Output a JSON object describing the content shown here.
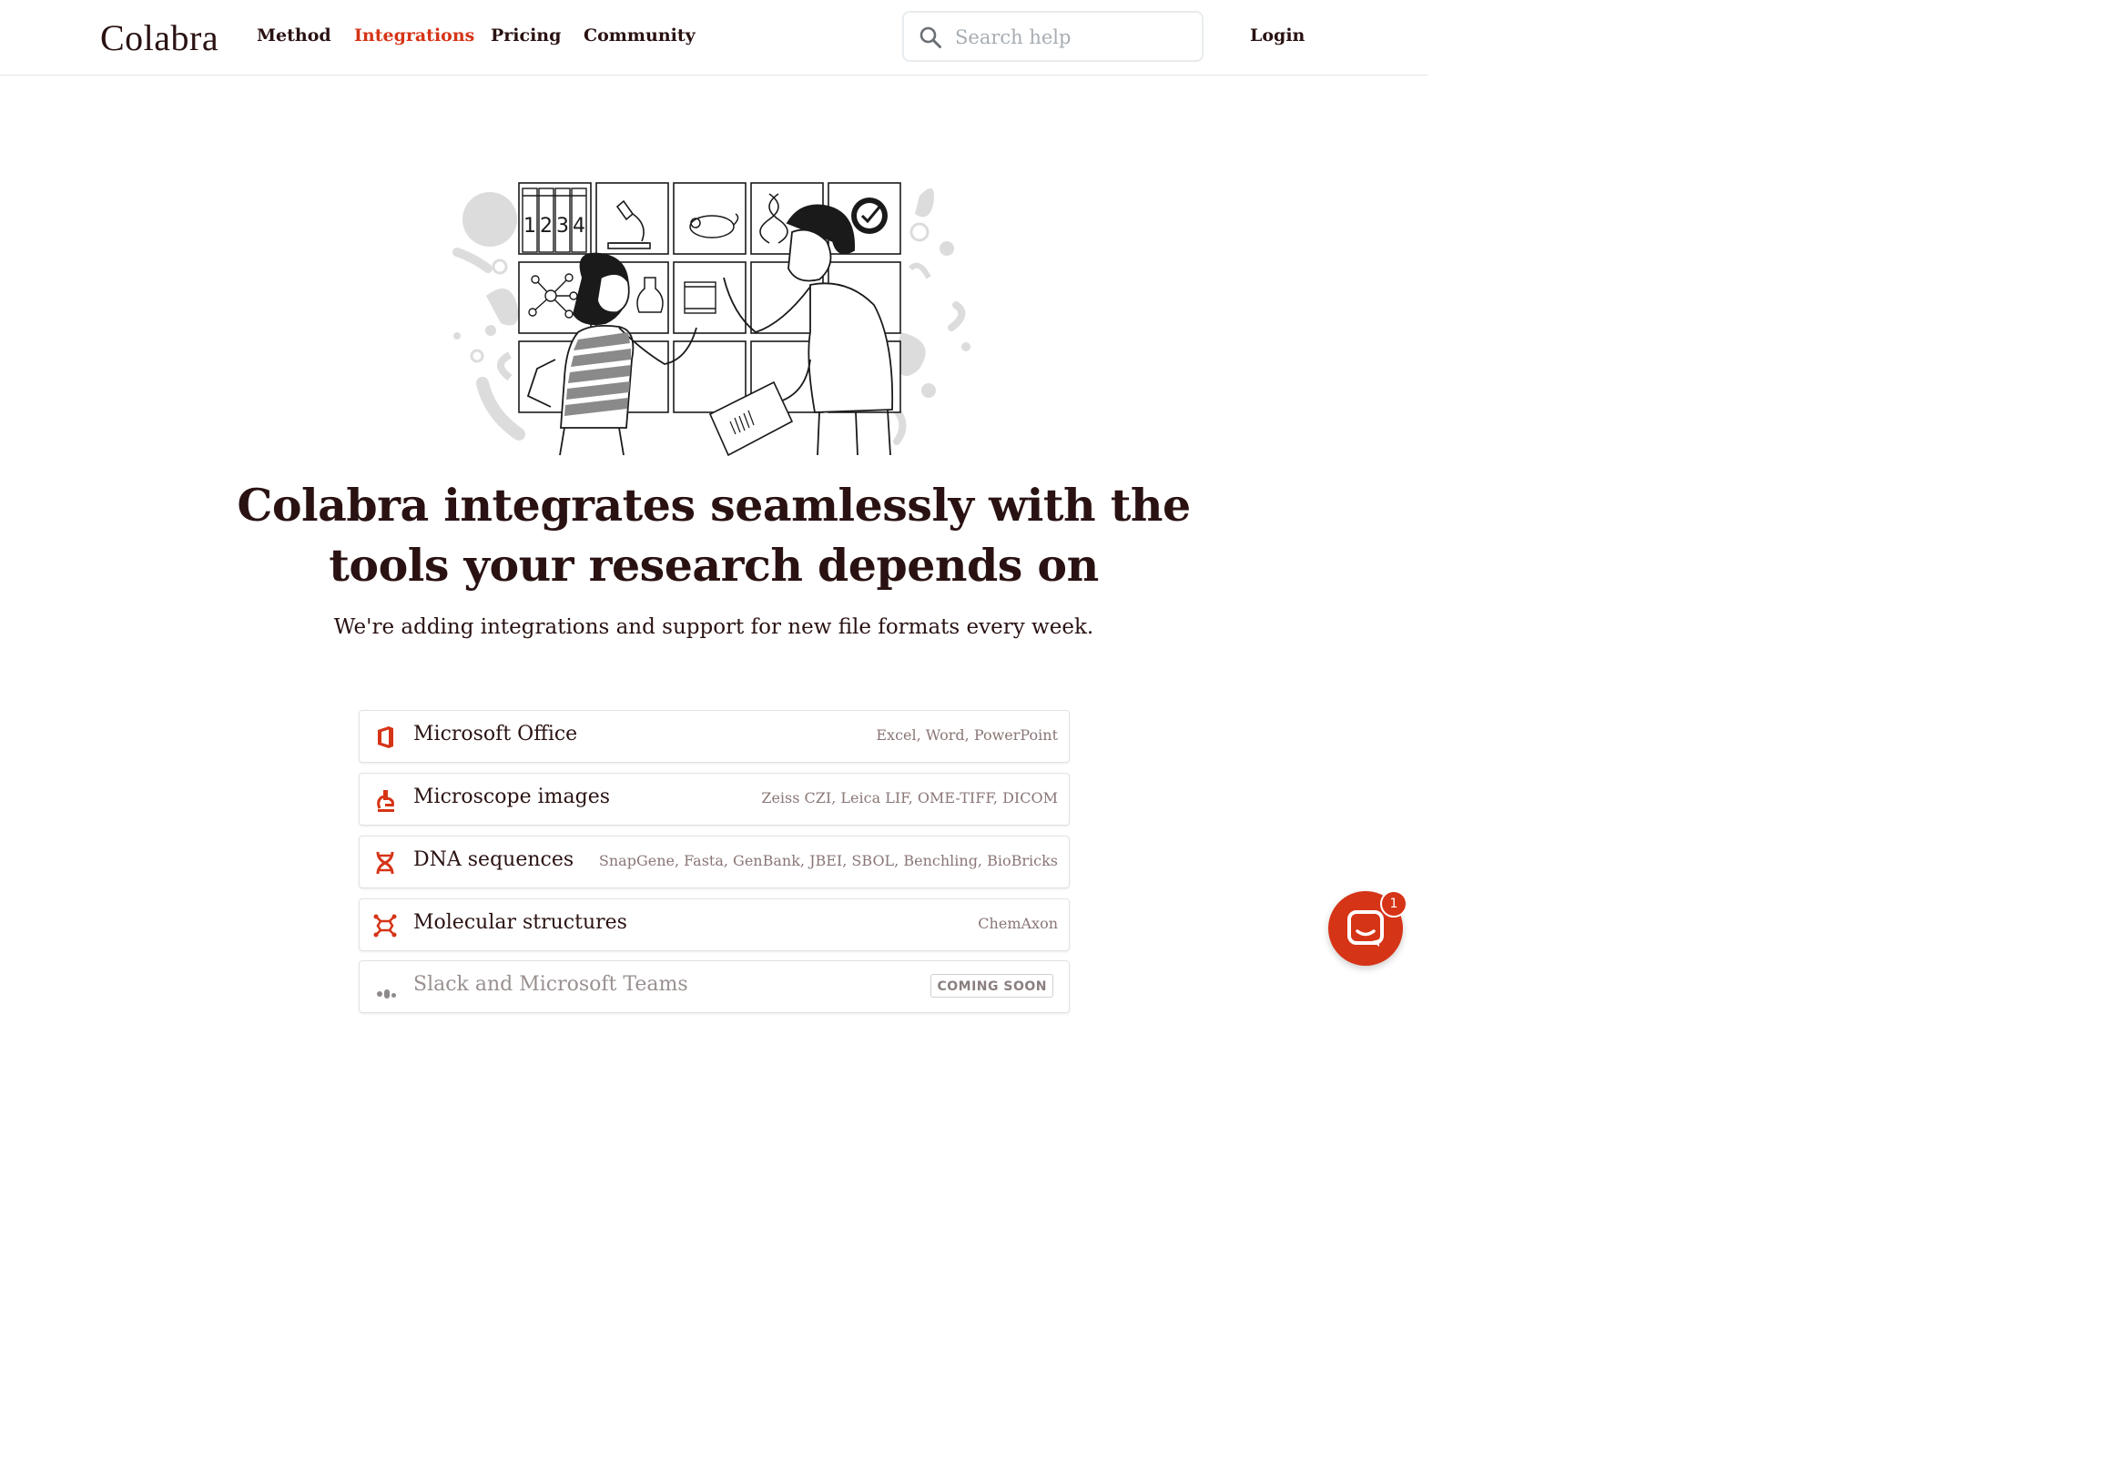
{
  "nav": {
    "logo": "Colabra",
    "links": [
      {
        "label": "Method",
        "active": false
      },
      {
        "label": "Integrations",
        "active": true
      },
      {
        "label": "Pricing",
        "active": false
      },
      {
        "label": "Community",
        "active": false
      }
    ],
    "search_placeholder": "Search help",
    "login_label": "Login"
  },
  "hero": {
    "illustration": "two-researchers-high-five-illustration",
    "headline": "Colabra integrates seamlessly with the tools your research depends on",
    "subtitle": "We're adding integrations and support for new file formats every week."
  },
  "integrations": [
    {
      "icon": "microsoft-office-icon",
      "label": "Microsoft Office",
      "formats": "Excel, Word, PowerPoint"
    },
    {
      "icon": "microscope-icon",
      "label": "Microscope images",
      "formats": "Zeiss CZI, Leica LIF, OME-TIFF, DICOM"
    },
    {
      "icon": "dna-icon",
      "label": "DNA sequences",
      "formats": "SnapGene, Fasta, GenBank, JBEI, SBOL, Benchling, BioBricks"
    },
    {
      "icon": "molecule-icon",
      "label": "Molecular structures",
      "formats": "ChemAxon"
    },
    {
      "icon": "chat-apps-icon",
      "label": "Slack and Microsoft Teams",
      "badge": "COMING SOON"
    }
  ],
  "chat_widget": {
    "badge_count": "1"
  },
  "colors": {
    "accent": "#d63417",
    "text": "#2a1212",
    "muted": "#8a7676"
  }
}
